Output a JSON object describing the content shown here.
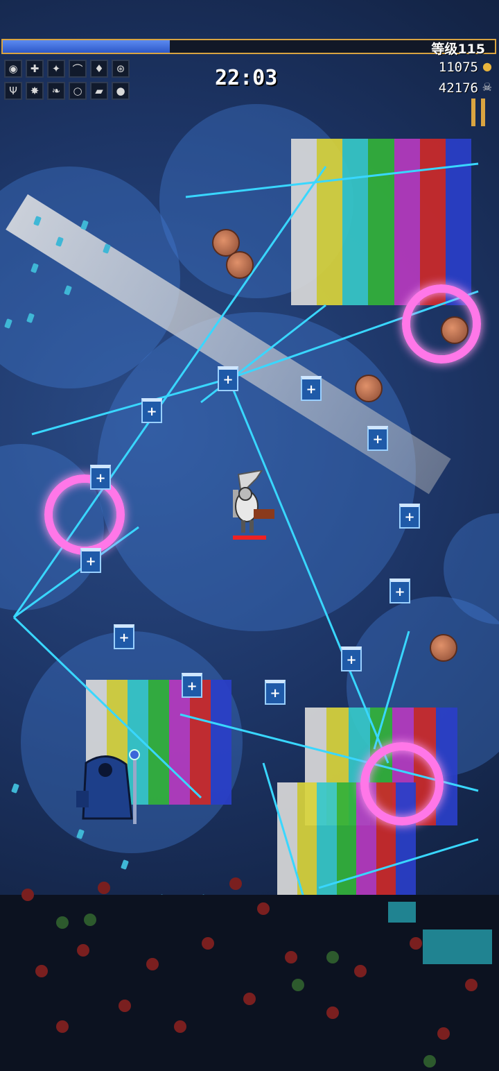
{
  "hud": {
    "level_label": "等级115",
    "level_progress": 0.34,
    "timer": "22:03",
    "gold": "11075",
    "kills": "42176",
    "gold_icon": "coin-icon",
    "kills_icon": "skull-icon",
    "pause_icon": "pause-icon"
  },
  "weapon_slots": [
    {
      "icon": "ring-weapon-icon",
      "glyph": "◉"
    },
    {
      "icon": "king-bible-icon",
      "glyph": "✚"
    },
    {
      "icon": "cross-icon",
      "glyph": "✦"
    },
    {
      "icon": "whip-icon",
      "glyph": "⌒"
    },
    {
      "icon": "holy-water-icon",
      "glyph": "♦"
    },
    {
      "icon": "clock-lancet-icon",
      "glyph": "⊛"
    }
  ],
  "passive_slots": [
    {
      "icon": "candelabrador-icon",
      "glyph": "Ψ"
    },
    {
      "icon": "spinach-icon",
      "glyph": "✸"
    },
    {
      "icon": "wings-icon",
      "glyph": "❧"
    },
    {
      "icon": "attractorb-icon",
      "glyph": "○"
    },
    {
      "icon": "armor-icon",
      "glyph": "▰"
    },
    {
      "icon": "empty-tome-icon",
      "glyph": "●"
    }
  ],
  "colors": {
    "xp_fill": "#3a6fe0",
    "frame": "#d9a441",
    "laser": "#39d7ff",
    "ring": "#ff77e8"
  }
}
